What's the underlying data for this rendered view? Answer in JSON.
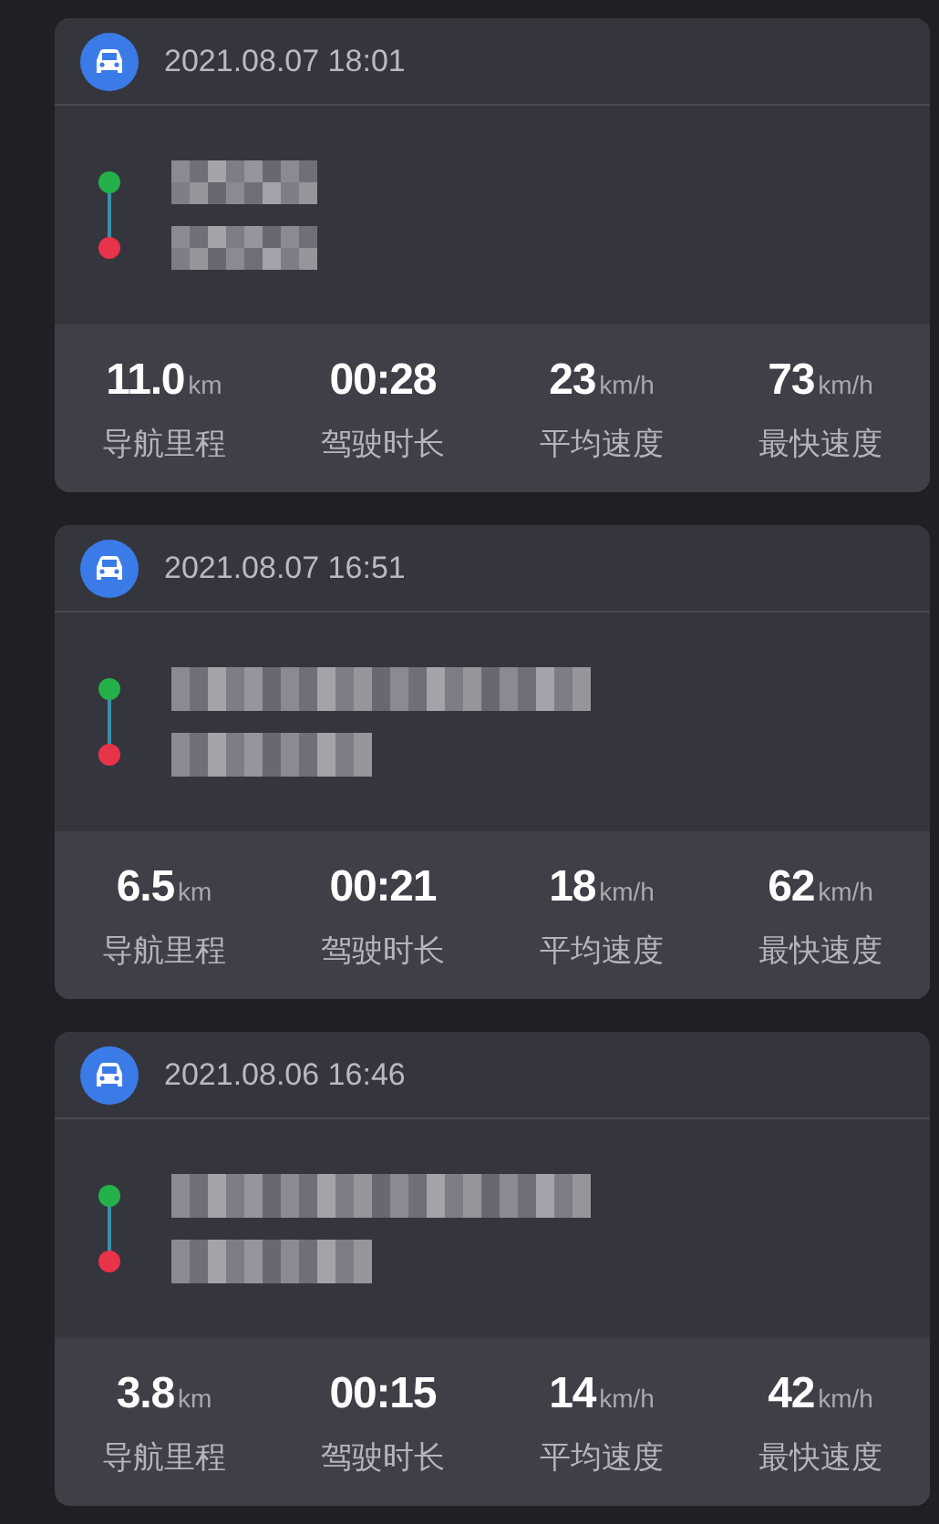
{
  "trips": [
    {
      "time": "2021.08.07 18:01",
      "origin": {
        "kind": "redacted_short"
      },
      "destination": {
        "kind": "redacted_short"
      },
      "stats": [
        {
          "value": "11.0",
          "unit": "km",
          "label": "导航里程"
        },
        {
          "value": "00:28",
          "label": "驾驶时长"
        },
        {
          "value": "23",
          "unit": "km/h",
          "label": "平均速度"
        },
        {
          "value": "73",
          "unit": "km/h",
          "label": "最快速度"
        }
      ]
    },
    {
      "time": "2021.08.07 16:51",
      "origin": {
        "kind": "redacted_long"
      },
      "destination": {
        "kind": "redacted_medium"
      },
      "stats": [
        {
          "value": "6.5",
          "unit": "km",
          "label": "导航里程"
        },
        {
          "value": "00:21",
          "label": "驾驶时长"
        },
        {
          "value": "18",
          "unit": "km/h",
          "label": "平均速度"
        },
        {
          "value": "62",
          "unit": "km/h",
          "label": "最快速度"
        }
      ]
    },
    {
      "time": "2021.08.06 16:46",
      "origin": {
        "kind": "redacted_long"
      },
      "destination": {
        "kind": "redacted_medium"
      },
      "stats": [
        {
          "value": "3.8",
          "unit": "km",
          "label": "导航里程"
        },
        {
          "value": "00:15",
          "label": "驾驶时长"
        },
        {
          "value": "14",
          "unit": "km/h",
          "label": "平均速度"
        },
        {
          "value": "42",
          "unit": "km/h",
          "label": "最快速度"
        }
      ]
    }
  ]
}
